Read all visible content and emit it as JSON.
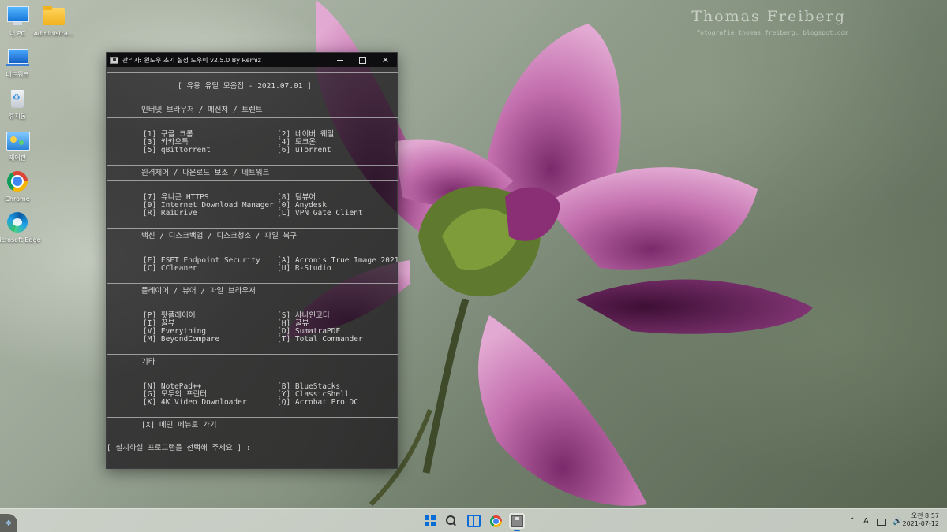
{
  "wallpaper": {
    "watermark": "Thomas Freiberg",
    "watermark_sub": "fotografie thomas freiberg, blogspot.com"
  },
  "desktop": {
    "icons": [
      {
        "label": "내 PC",
        "icon": "pc-icon"
      },
      {
        "label": "Administra...",
        "icon": "folder-icon"
      },
      {
        "label": "네트워크",
        "icon": "network-icon"
      },
      {
        "label": "휴지통",
        "icon": "recycle-bin-icon"
      },
      {
        "label": "제어판",
        "icon": "control-panel-icon"
      },
      {
        "label": "Chrome",
        "icon": "chrome-icon"
      },
      {
        "label": "Microsoft Edge",
        "icon": "edge-icon"
      }
    ]
  },
  "window": {
    "title": "관리자: 윈도우 초기 설정 도우미 v2.5.0 By Remiz",
    "close_glyph": "✕",
    "header": "[ 유용 유틸 모음집 - 2021.07.01 ]",
    "sections": [
      {
        "title": "인터넷 브라우저 / 메신저 / 토렌트",
        "items": [
          [
            "[1] 구글 크롬",
            "[2] 네이버 웨일"
          ],
          [
            "[3] 카카오톡",
            "[4] 토크온"
          ],
          [
            "[5] qBittorrent",
            "[6] uTorrent"
          ]
        ]
      },
      {
        "title": "원격제어 / 다운로드 보조 / 네트워크",
        "items": [
          [
            "[7] 유니콘 HTTPS",
            "[8] 팀뷰어"
          ],
          [
            "[9] Internet Download Manager",
            "[0] Anydesk"
          ],
          [
            "[R] RaiDrive",
            "[L] VPN Gate Client"
          ]
        ]
      },
      {
        "title": "백신 / 디스크백업 / 디스크청소 / 파일 복구",
        "items": [
          [
            "[E] ESET Endpoint Security",
            "[A] Acronis True Image 2021"
          ],
          [
            "[C] CCleaner",
            "[U] R-Studio"
          ]
        ]
      },
      {
        "title": "플레이어 / 뷰어 / 파일 브라우저",
        "items": [
          [
            "[P] 팟플레이어",
            "[S] 샤나인코더"
          ],
          [
            "[I] 꿀뷰",
            "[H] 꿀뷰"
          ],
          [
            "[V] Everything",
            "[D] SumatraPDF"
          ],
          [
            "[M] BeyondCompare",
            "[T] Total Commander"
          ]
        ]
      },
      {
        "title": "기타",
        "items": [
          [
            "[N] NotePad++",
            "[B] BlueStacks"
          ],
          [
            "[G] 모두의 프린터",
            "[Y] ClassicShell"
          ],
          [
            "[K] 4K Video Downloader",
            "[Q] Acrobat Pro DC"
          ]
        ]
      }
    ],
    "back_option": "[X] 메인 메뉴로 가기",
    "prompt": "[ 설치하실 프로그램을 선택해 주세요 ] :"
  },
  "taskbar": {
    "start_orb_glyph": "❖",
    "icons": [
      "windows-start-icon",
      "search-icon",
      "task-view-icon",
      "chrome-icon",
      "console-app-icon"
    ],
    "tray": {
      "chevron": "^",
      "ime": "A",
      "volume": "🔊"
    },
    "clock_time": "오전 8:57",
    "clock_date": "2021-07-12"
  }
}
